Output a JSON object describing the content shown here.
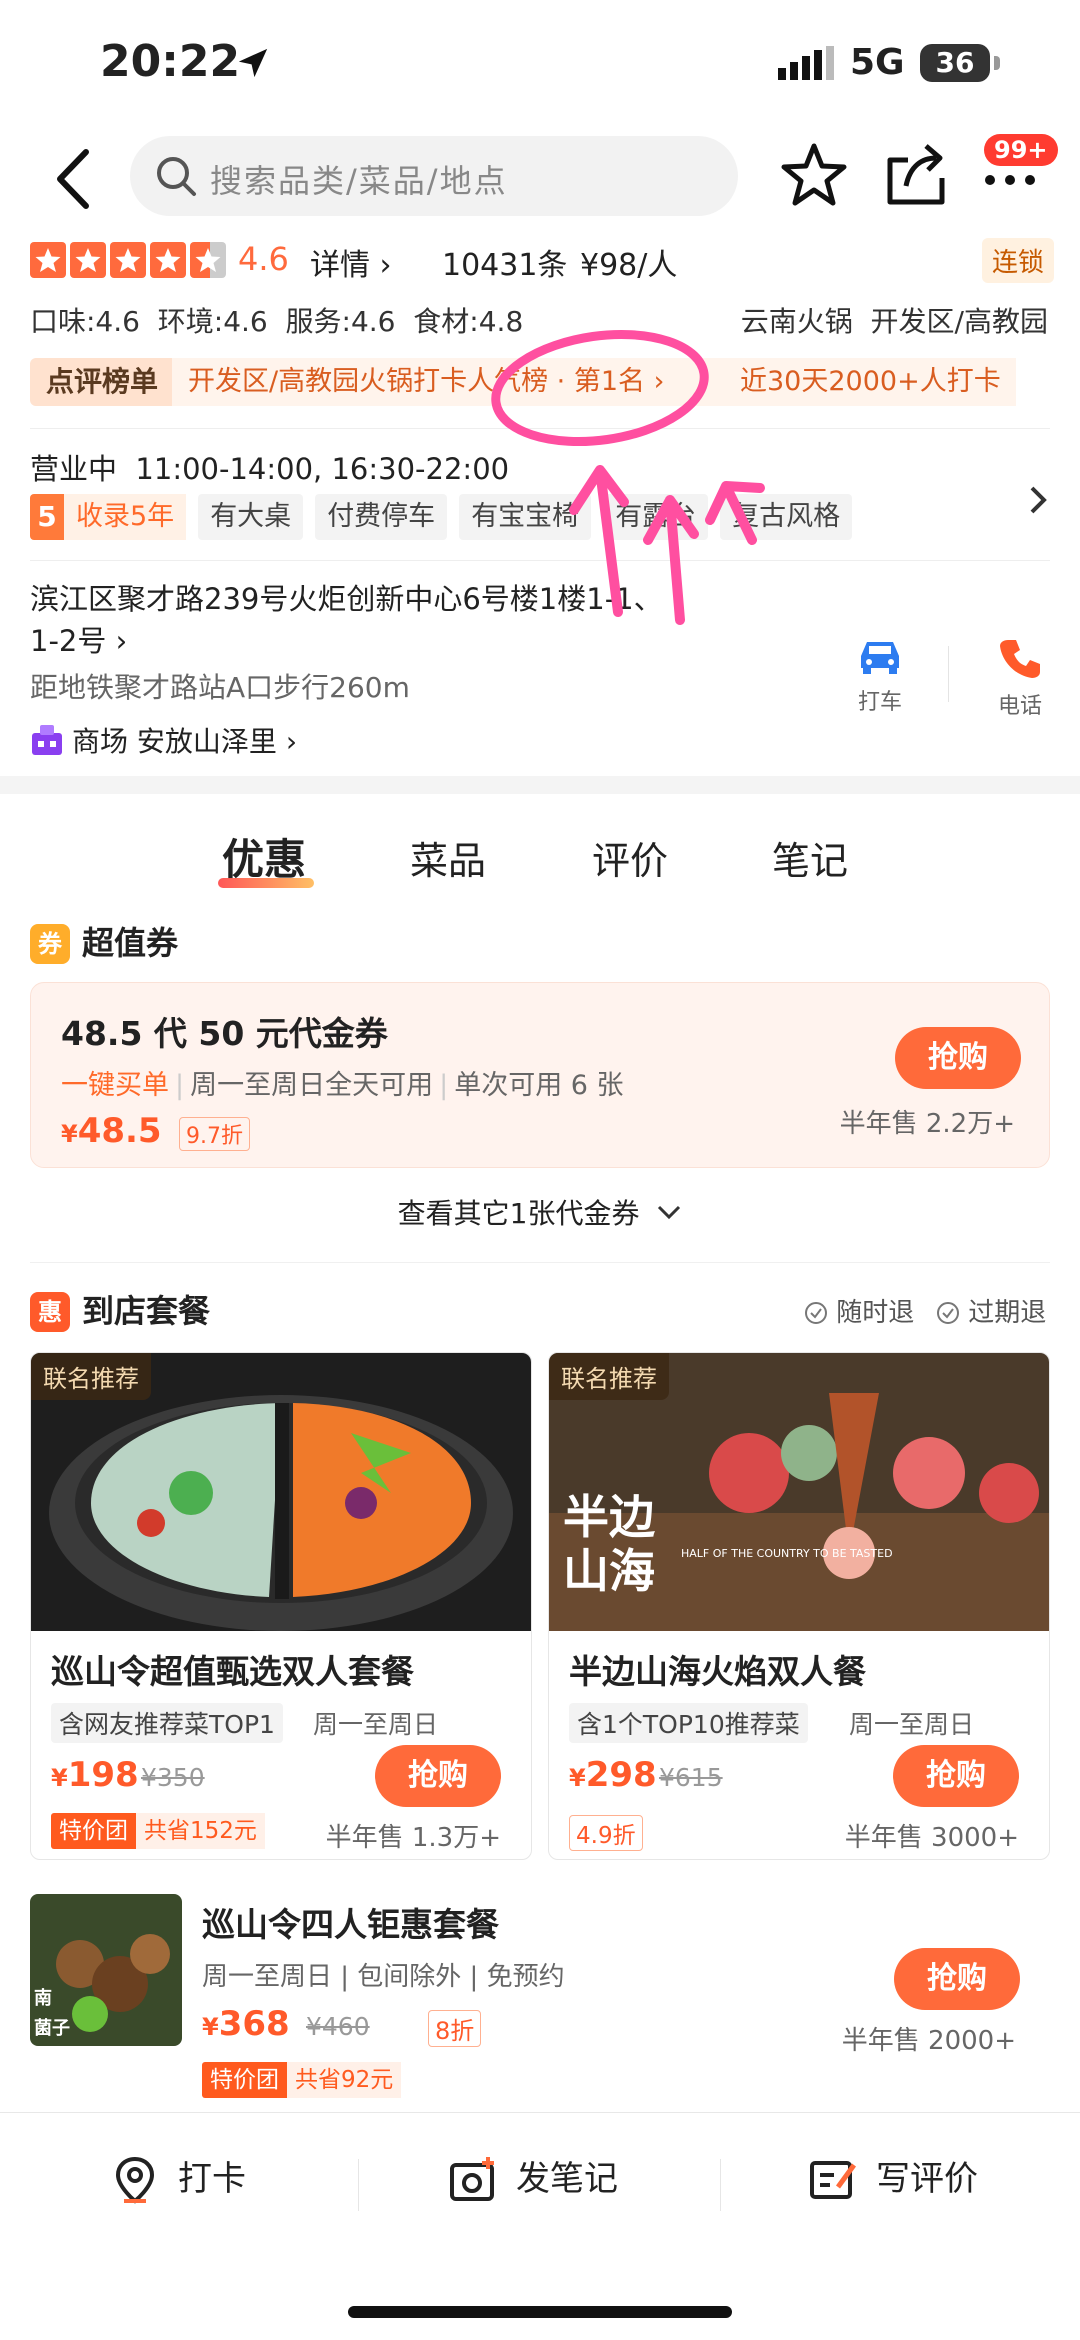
{
  "status_bar": {
    "time": "20:22",
    "network": "5G",
    "battery": "36"
  },
  "header": {
    "search_placeholder": "搜索品类/菜品/地点",
    "badge": "99+"
  },
  "shop": {
    "score": "4.6",
    "detail_link": "详情",
    "review_count": "10431条",
    "avg_price": "¥98/人",
    "chain_tag": "连锁",
    "sub_scores": "口味:4.6  环境:4.6  服务:4.6  食材:4.8",
    "category_area": "云南火锅  开发区/高教园",
    "rank_label": "点评榜单",
    "rank_text": "开发区/高教园火锅打卡人气榜 · 第1名",
    "rank_text2": "近30天2000+人打卡",
    "hours": "营业中  11:00-14:00, 16:30-22:00",
    "tag_years_num": "5",
    "tag_years": "收录5年",
    "tags": [
      "有大桌",
      "付费停车",
      "有宝宝椅",
      "有露台",
      "复古风格"
    ],
    "address": "滨江区聚才路239号火炬创新中心6号楼1楼1-1、1-2号",
    "metro": "距地铁聚才路站A口步行260m",
    "mall_label": "商场",
    "mall_name": "安放山泽里",
    "taxi_label": "打车",
    "phone_label": "电话"
  },
  "tabs": [
    "优惠",
    "菜品",
    "评价",
    "笔记"
  ],
  "coupon_section": {
    "title": "超值券",
    "icon_text": "券",
    "coupon": {
      "name": "48.5 代 50 元代金券",
      "highlight": "一键买单",
      "desc1": "周一至周日全天可用",
      "desc2": "单次可用 6 张",
      "currency": "¥",
      "price": "48.5",
      "discount": "9.7折",
      "buy_label": "抢购",
      "sold": "半年售 2.2万+"
    },
    "more": "查看其它1张代金券"
  },
  "package_section": {
    "title": "到店套餐",
    "icon_text": "惠",
    "refund_anytime": "随时退",
    "refund_expired": "过期退",
    "cards": [
      {
        "rec": "联名推荐",
        "title": "巡山令超值甄选双人套餐",
        "chip": "含网友推荐菜TOP1",
        "days": "周一至周日",
        "currency": "¥",
        "price": "198",
        "orig": "¥350",
        "sp_a": "特价团",
        "sp_b": "共省152元",
        "buy_label": "抢购",
        "sold": "半年售 1.3万+"
      },
      {
        "rec": "联名推荐",
        "title": "半边山海火焰双人餐",
        "chip": "含1个TOP10推荐菜",
        "days": "周一至周日",
        "currency": "¥",
        "price": "298",
        "orig": "¥615",
        "discount": "4.9折",
        "buy_label": "抢购",
        "sold": "半年售 3000+",
        "img_text_big": "半边\n山海",
        "img_text_small": "HALF OF THE COUNTRY TO BE TASTED"
      }
    ],
    "list_item": {
      "title": "巡山令四人钜惠套餐",
      "desc": "周一至周日 | 包间除外 | 免预约",
      "currency": "¥",
      "price": "368",
      "orig": "¥460",
      "discount": "8折",
      "sp_a": "特价团",
      "sp_b": "共省92元",
      "buy_label": "抢购",
      "sold": "半年售 2000+"
    }
  },
  "bottom_bar": {
    "checkin": "打卡",
    "note": "发笔记",
    "review": "写评价"
  },
  "colors": {
    "accent": "#ff6a3a",
    "star": "#ff6a3d",
    "annotation": "#ff4fa0"
  }
}
